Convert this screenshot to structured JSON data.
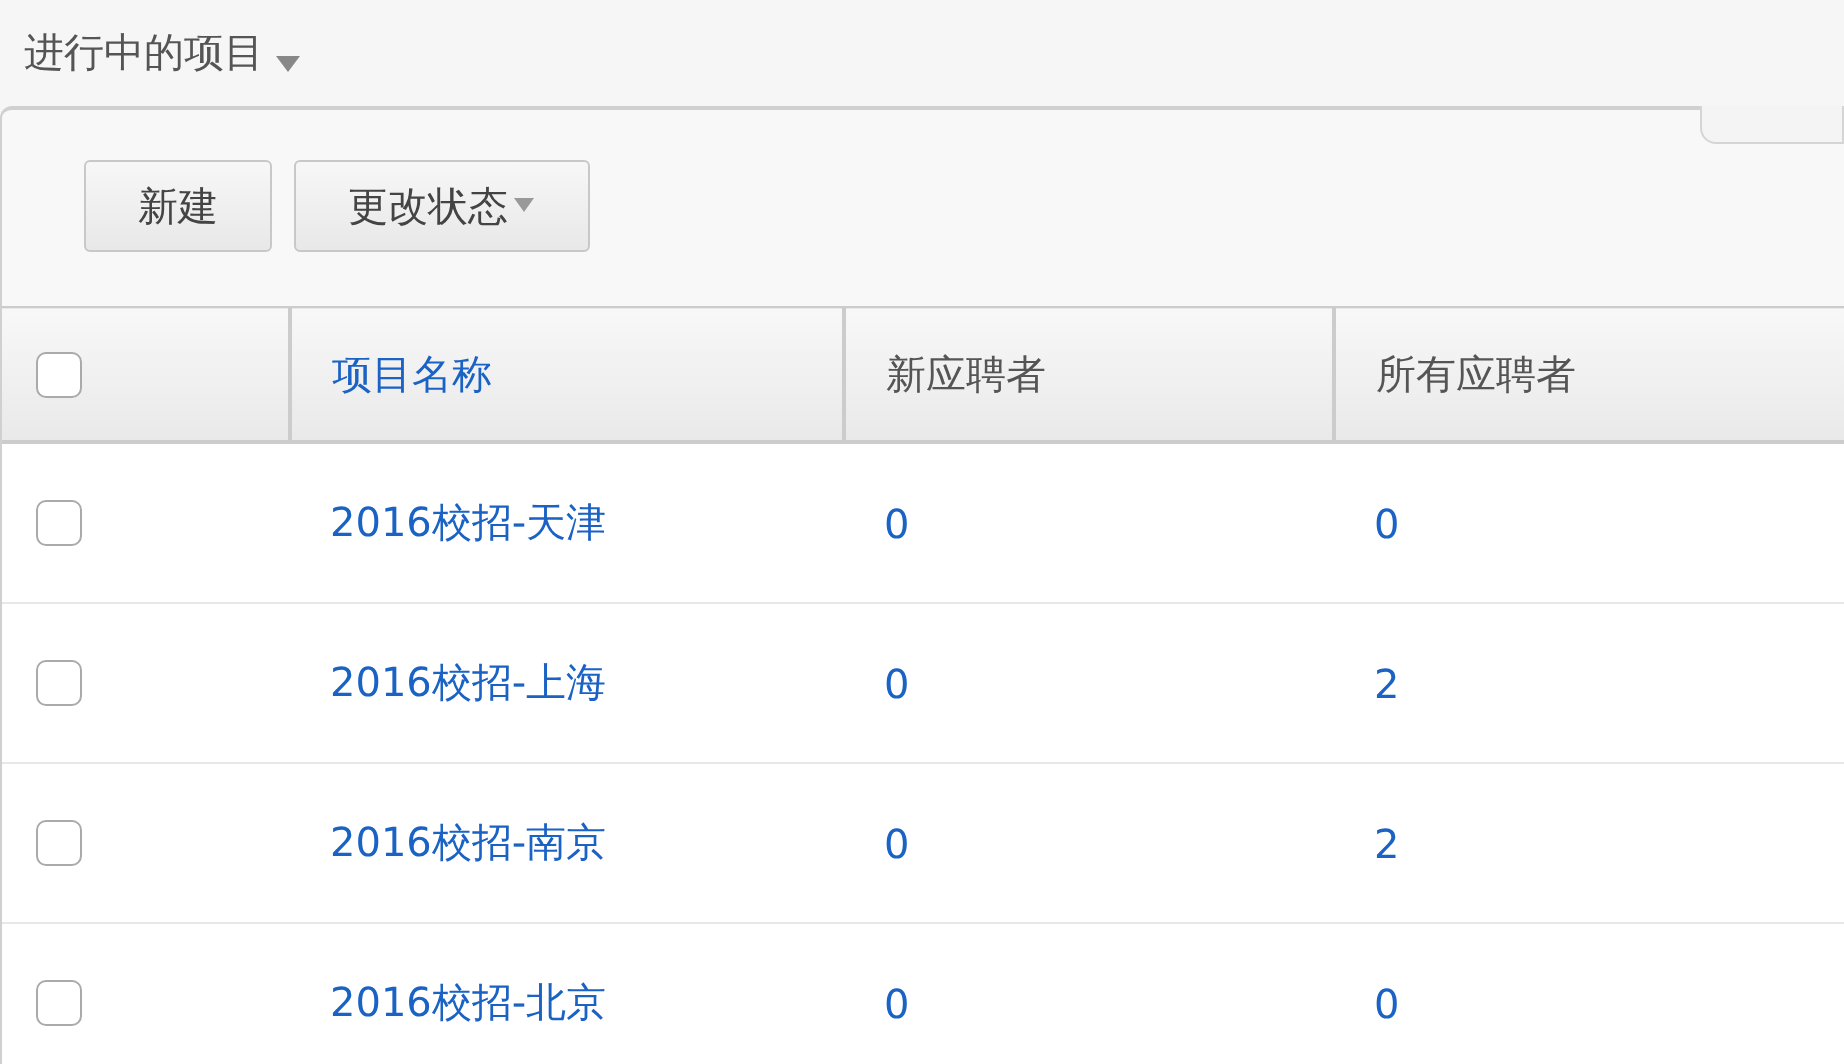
{
  "title": "进行中的项目",
  "toolbar": [
    {
      "label": "新建",
      "dropdown": false
    },
    {
      "label": "更改状态",
      "dropdown": true
    }
  ],
  "table": {
    "select_all": {
      "checked": false
    },
    "columns": [
      {
        "label": "项目名称",
        "link": true
      },
      {
        "label": "新应聘者",
        "link": false
      },
      {
        "label": "所有应聘者",
        "link": false
      }
    ],
    "rows": [
      {
        "checked": false,
        "cells": [
          "2016校招-天津",
          "0",
          "0"
        ]
      },
      {
        "checked": false,
        "cells": [
          "2016校招-上海",
          "0",
          "2"
        ]
      },
      {
        "checked": false,
        "cells": [
          "2016校招-南京",
          "0",
          "2"
        ]
      },
      {
        "checked": false,
        "cells": [
          "2016校招-北京",
          "0",
          "0"
        ]
      }
    ]
  }
}
